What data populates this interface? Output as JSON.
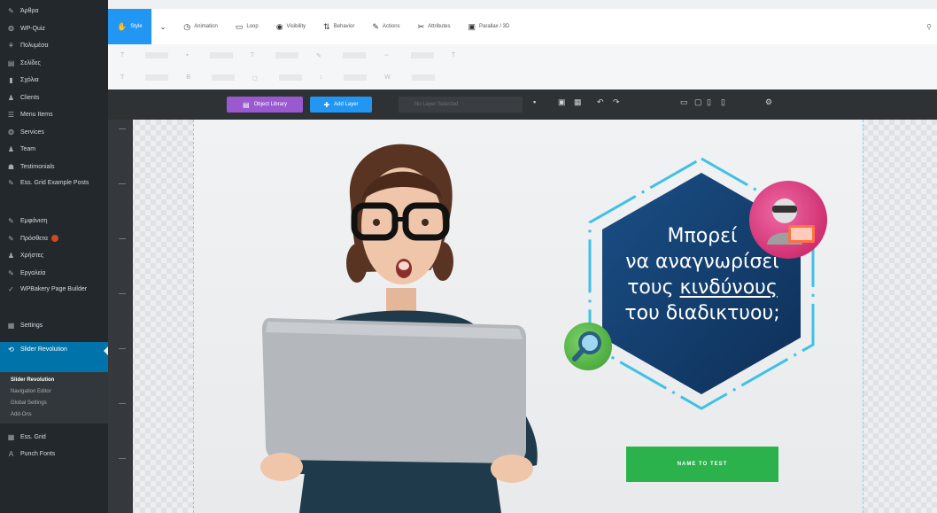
{
  "sidebar": {
    "items": [
      {
        "icon": "pin-icon",
        "label": "Άρθρα"
      },
      {
        "icon": "quiz-icon",
        "label": "WP-Quiz"
      },
      {
        "icon": "media-icon",
        "label": "Πολυμέσα"
      },
      {
        "icon": "pages-icon",
        "label": "Σελίδες"
      },
      {
        "icon": "comments-icon",
        "label": "Σχόλια"
      },
      {
        "icon": "clients-icon",
        "label": "Clients"
      },
      {
        "icon": "menu-items-icon",
        "label": "Menu Items"
      },
      {
        "icon": "services-icon",
        "label": "Services"
      },
      {
        "icon": "team-icon",
        "label": "Team"
      },
      {
        "icon": "testimonials-icon",
        "label": "Testimonials"
      },
      {
        "icon": "grid-posts-icon",
        "label": "Ess. Grid Example Posts"
      },
      {
        "icon": "appearance-icon",
        "label": "Εμφάνιση"
      },
      {
        "icon": "plugins-icon",
        "label": "Πρόσθετα"
      },
      {
        "icon": "users-icon",
        "label": "Χρήστες"
      },
      {
        "icon": "tools-icon",
        "label": "Εργαλεία"
      },
      {
        "icon": "wpbakery-icon",
        "label": "WPBakery Page Builder"
      },
      {
        "icon": "settings-icon",
        "label": "Settings"
      },
      {
        "icon": "slider-revolution-icon",
        "label": "Slider Revolution"
      }
    ],
    "submenu": [
      "Slider Revolution",
      "Navigation Editor",
      "Global Settings",
      "Add-Ons"
    ],
    "bottom_items": [
      {
        "icon": "ess-grid-icon",
        "label": "Ess. Grid"
      },
      {
        "icon": "punch-fonts-icon",
        "label": "Punch Fonts"
      }
    ]
  },
  "toolbar": {
    "tabs": [
      {
        "icon": "style-icon",
        "label": "Style"
      },
      {
        "icon": "animation-icon",
        "label": "Animation"
      },
      {
        "icon": "loop-icon",
        "label": "Loop"
      },
      {
        "icon": "visibility-icon",
        "label": "Visibility"
      },
      {
        "icon": "behavior-icon",
        "label": "Behavior"
      },
      {
        "icon": "actions-icon",
        "label": "Actions"
      },
      {
        "icon": "attributes-icon",
        "label": "Attributes"
      },
      {
        "icon": "parallax-icon",
        "label": "Parallax / 3D"
      }
    ],
    "dropdown_caret": "⌄"
  },
  "editor_bar": {
    "object_library": "Object Library",
    "add_layer": "Add Layer",
    "layer_select_placeholder": "No Layer Selected"
  },
  "slide": {
    "title_line1": "Μπορεί",
    "title_line2": "να αναγνωρίσει",
    "title_line3_prefix": "τους ",
    "title_line3_underlined": "κινδύνους",
    "title_line4": "του διαδικτυου;",
    "cta_label": "NAME TO TEST",
    "colors": {
      "hexagon_fill": "#1a4f86",
      "hexagon_fill_dark": "#0e2f57",
      "dashed_border": "#3fc1e6",
      "cta": "#2bb24c",
      "badge_pink": "#d81b60",
      "badge_green": "#4caf50"
    }
  }
}
